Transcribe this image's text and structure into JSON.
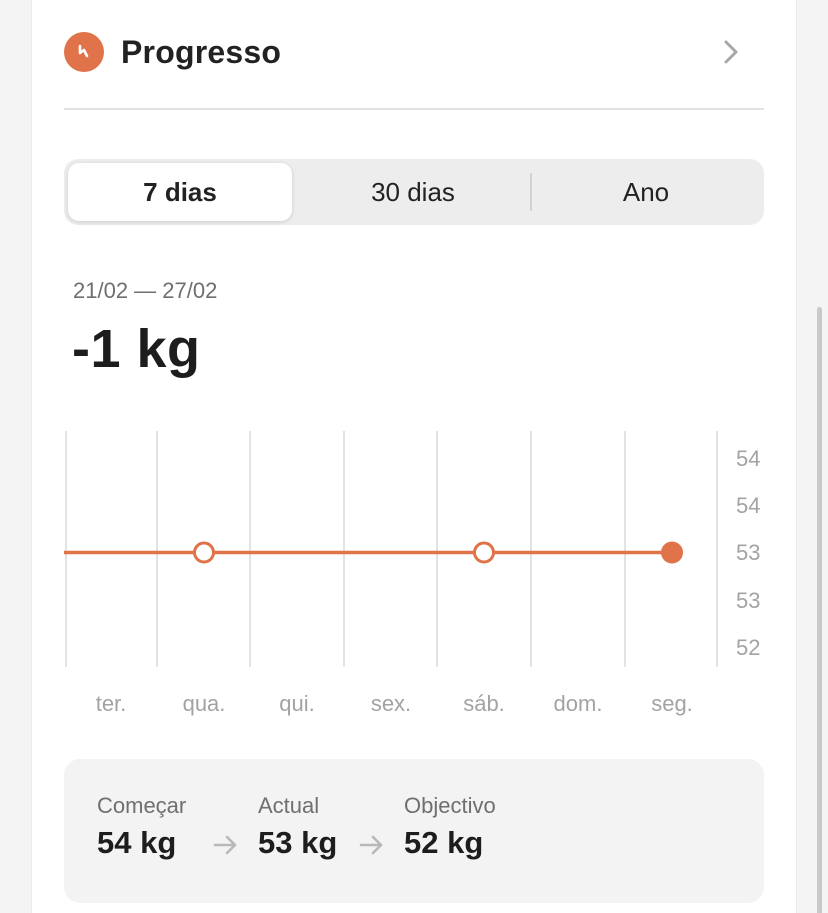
{
  "header": {
    "title": "Progresso",
    "icon": "scale-trend-icon",
    "accent_color": "#e0734a"
  },
  "tabs": [
    {
      "label": "7 dias",
      "active": true
    },
    {
      "label": "30 dias",
      "active": false
    },
    {
      "label": "Ano",
      "active": false
    }
  ],
  "summary": {
    "date_range": "21/02 — 27/02",
    "change": "-1 kg"
  },
  "chart_data": {
    "type": "line",
    "title": "",
    "xlabel": "",
    "ylabel": "",
    "categories": [
      "ter.",
      "qua.",
      "qui.",
      "sex.",
      "sáb.",
      "dom.",
      "seg."
    ],
    "y_tick_labels": [
      "54",
      "54",
      "53",
      "53",
      "52"
    ],
    "ylim": [
      52,
      54
    ],
    "grid": true,
    "line_color": "#e0734a",
    "series": [
      {
        "values": [
          null,
          53,
          null,
          null,
          53,
          null,
          53
        ],
        "markers": [
          null,
          "hollow",
          null,
          null,
          "hollow",
          null,
          "filled"
        ]
      }
    ]
  },
  "stats": {
    "start": {
      "label": "Começar",
      "value": "54 kg"
    },
    "current": {
      "label": "Actual",
      "value": "53 kg"
    },
    "goal": {
      "label": "Objectivo",
      "value": "52 kg"
    }
  }
}
